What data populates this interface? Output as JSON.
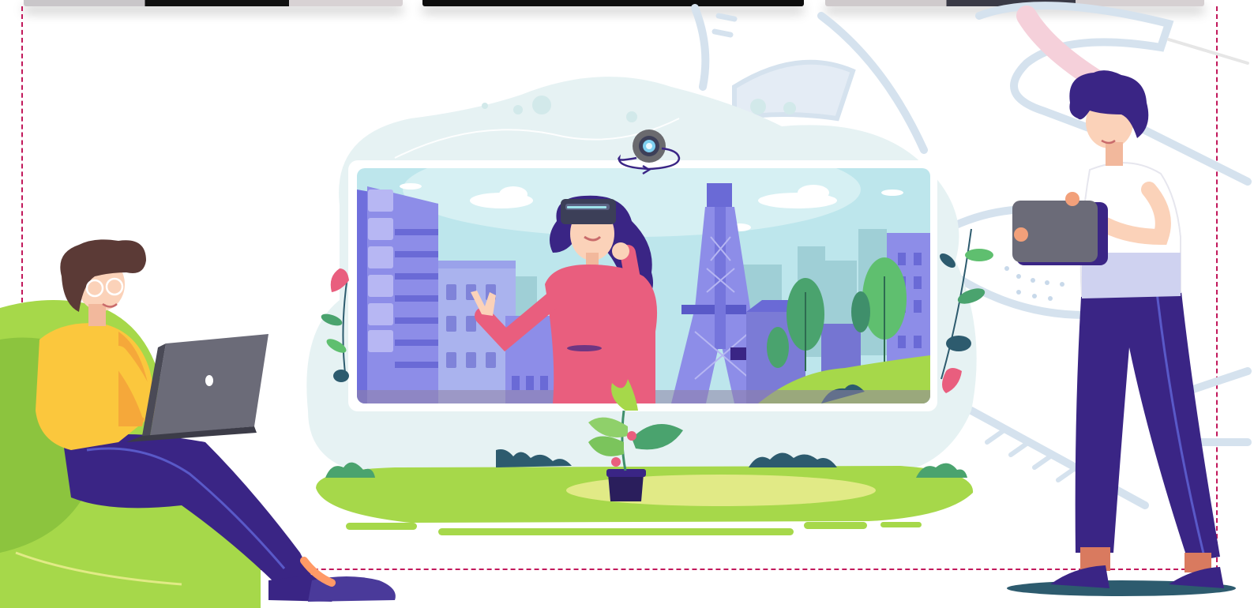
{
  "image": {
    "kind": "flat vector illustration",
    "colors": {
      "accent_purple": "#3a2585",
      "screen_purple": "#8d8de8",
      "lawn_green": "#a6d84a",
      "sweater_yellow": "#fbc73d",
      "top_pink": "#e95e7e",
      "frame_dash": "#c2185b",
      "sky": "#bde6ec"
    },
    "icons": [
      "webcam-icon",
      "rotate-arrow-icon",
      "vr-headset-icon",
      "laptop-icon",
      "tablet-icon"
    ]
  }
}
